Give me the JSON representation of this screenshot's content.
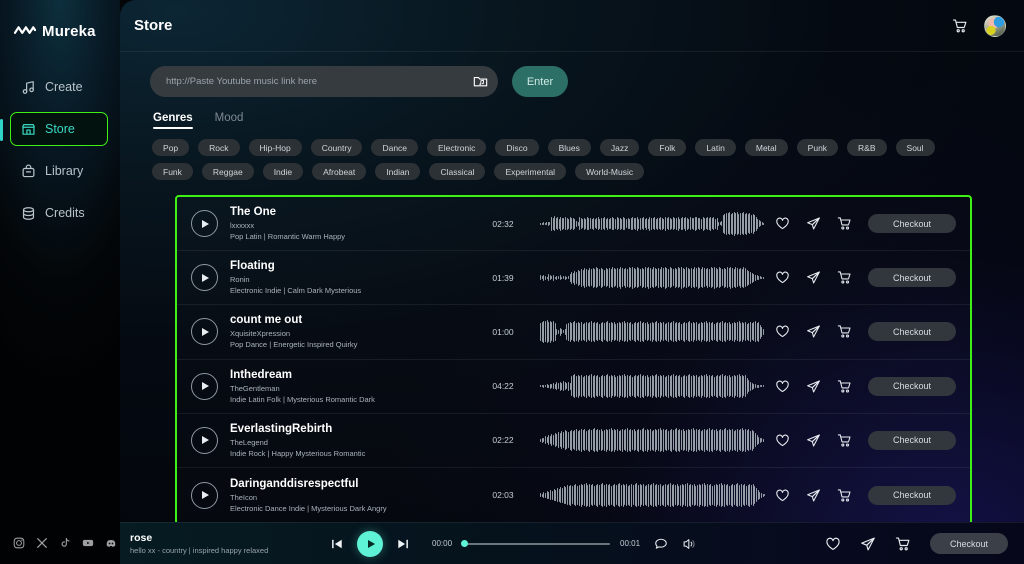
{
  "brand": {
    "name": "Mureka",
    "logo_icon": "waveform-logo-icon"
  },
  "sidebar": {
    "items": [
      {
        "label": "Create",
        "icon": "music-note-icon",
        "active": false
      },
      {
        "label": "Store",
        "icon": "storefront-icon",
        "active": true
      },
      {
        "label": "Library",
        "icon": "bag-icon",
        "active": false
      },
      {
        "label": "Credits",
        "icon": "database-icon",
        "active": false
      }
    ],
    "social": [
      {
        "name": "instagram-icon"
      },
      {
        "name": "x-twitter-icon"
      },
      {
        "name": "tiktok-icon"
      },
      {
        "name": "youtube-icon"
      },
      {
        "name": "discord-icon"
      }
    ]
  },
  "header": {
    "title": "Store",
    "cart_icon": "cart-icon",
    "avatar_icon": "user-avatar"
  },
  "search": {
    "placeholder": "http://Paste Youtube music link here",
    "value": "",
    "folder_icon": "folder-music-icon",
    "enter_label": "Enter"
  },
  "tabs": [
    {
      "label": "Genres",
      "active": true
    },
    {
      "label": "Mood",
      "active": false
    }
  ],
  "genres": [
    "Pop",
    "Rock",
    "Hip-Hop",
    "Country",
    "Dance",
    "Electronic",
    "Disco",
    "Blues",
    "Jazz",
    "Folk",
    "Latin",
    "Metal",
    "Punk",
    "R&B",
    "Soul",
    "Funk",
    "Reggae",
    "Indie",
    "Afrobeat",
    "Indian",
    "Classical",
    "Experimental",
    "World-Music"
  ],
  "tracks": [
    {
      "title": "The One",
      "artist": "lxxxxxx",
      "tags": "Pop Latin | Romantic Warm Happy",
      "duration": "02:32",
      "checkout_label": "Checkout",
      "waveform": [
        2,
        2,
        3,
        2,
        3,
        4,
        3,
        14,
        12,
        15,
        11,
        13,
        10,
        14,
        12,
        11,
        13,
        12,
        10,
        13,
        11,
        12,
        10,
        6,
        4,
        13,
        11,
        9,
        12,
        10,
        13,
        12,
        11,
        10,
        12,
        9,
        11,
        13,
        10,
        12,
        11,
        13,
        9,
        12,
        10,
        11,
        13,
        12,
        10,
        13,
        11,
        12,
        10,
        13,
        12,
        9,
        11,
        10,
        12,
        13,
        11,
        12,
        14,
        10,
        12,
        11,
        13,
        9,
        12,
        10,
        14,
        12,
        11,
        13,
        10,
        12,
        11,
        13,
        12,
        10,
        14,
        11,
        13,
        12,
        10,
        13,
        11,
        12,
        14,
        10,
        12,
        13,
        11,
        14,
        12,
        10,
        13,
        11,
        12,
        14,
        13,
        11,
        12,
        10,
        14,
        12,
        11,
        13,
        12,
        14,
        11,
        13,
        10,
        12,
        4,
        3,
        5,
        18,
        20,
        22,
        21,
        23,
        20,
        22,
        24,
        21,
        23,
        20,
        22,
        21,
        23,
        20,
        22,
        19,
        21,
        18,
        20,
        17,
        14,
        10,
        7,
        5,
        3,
        2
      ]
    },
    {
      "title": "Floating",
      "artist": "Ronin",
      "tags": "Electronic Indie | Calm Dark Mysterious",
      "duration": "01:39",
      "checkout_label": "Checkout",
      "waveform": [
        5,
        3,
        6,
        4,
        2,
        7,
        5,
        3,
        6,
        2,
        4,
        3,
        5,
        2,
        3,
        4,
        2,
        3,
        8,
        12,
        10,
        14,
        12,
        16,
        14,
        18,
        16,
        20,
        18,
        16,
        19,
        17,
        20,
        18,
        21,
        19,
        17,
        20,
        18,
        16,
        19,
        17,
        20,
        18,
        21,
        19,
        17,
        20,
        18,
        22,
        19,
        17,
        20,
        18,
        21,
        19,
        22,
        20,
        18,
        21,
        19,
        17,
        20,
        18,
        21,
        19,
        22,
        20,
        18,
        21,
        19,
        17,
        20,
        18,
        21,
        19,
        22,
        20,
        18,
        21,
        19,
        17,
        20,
        18,
        21,
        19,
        22,
        20,
        18,
        21,
        19,
        17,
        20,
        18,
        21,
        19,
        22,
        20,
        18,
        21,
        19,
        17,
        20,
        18,
        21,
        19,
        22,
        20,
        18,
        21,
        19,
        17,
        20,
        18,
        21,
        19,
        22,
        20,
        18,
        21,
        19,
        17,
        20,
        18,
        21,
        19,
        16,
        14,
        12,
        10,
        8,
        6,
        5,
        4,
        3,
        2,
        2,
        2
      ]
    },
    {
      "title": "count me out",
      "artist": "XquisiteXpression",
      "tags": "Pop Dance | Energetic Inspired Quirky",
      "duration": "01:00",
      "checkout_label": "Checkout",
      "waveform": [
        18,
        20,
        22,
        21,
        23,
        20,
        22,
        19,
        21,
        18,
        6,
        4,
        8,
        5,
        3,
        6,
        16,
        18,
        20,
        17,
        19,
        21,
        18,
        20,
        17,
        19,
        16,
        18,
        20,
        17,
        19,
        21,
        18,
        20,
        17,
        19,
        16,
        18,
        20,
        17,
        19,
        21,
        18,
        20,
        17,
        19,
        16,
        18,
        20,
        17,
        19,
        21,
        18,
        20,
        17,
        19,
        16,
        18,
        20,
        17,
        19,
        21,
        18,
        20,
        17,
        19,
        16,
        18,
        20,
        17,
        19,
        21,
        18,
        20,
        17,
        19,
        16,
        18,
        20,
        17,
        19,
        21,
        18,
        20,
        17,
        19,
        16,
        18,
        20,
        17,
        19,
        21,
        18,
        20,
        17,
        19,
        16,
        18,
        20,
        17,
        19,
        21,
        18,
        20,
        17,
        19,
        16,
        18,
        20,
        17,
        19,
        21,
        18,
        20,
        17,
        19,
        16,
        18,
        20,
        17,
        19,
        21,
        18,
        20,
        17,
        19,
        16,
        18,
        20,
        17,
        19,
        21,
        18,
        20,
        14,
        10,
        6,
        4
      ]
    },
    {
      "title": "Inthedream",
      "artist": "TheGentleman",
      "tags": "Indie Latin Folk | Mysterious Romantic Dark",
      "duration": "04:22",
      "checkout_label": "Checkout",
      "waveform": [
        2,
        2,
        3,
        2,
        4,
        3,
        5,
        4,
        6,
        5,
        8,
        6,
        9,
        7,
        10,
        8,
        6,
        9,
        7,
        20,
        22,
        24,
        21,
        23,
        20,
        22,
        19,
        21,
        23,
        20,
        22,
        24,
        21,
        23,
        20,
        22,
        19,
        21,
        23,
        20,
        22,
        24,
        21,
        23,
        20,
        22,
        19,
        21,
        23,
        20,
        22,
        24,
        21,
        23,
        20,
        22,
        19,
        21,
        23,
        20,
        22,
        24,
        21,
        23,
        20,
        22,
        19,
        21,
        23,
        20,
        22,
        24,
        21,
        23,
        20,
        22,
        19,
        21,
        23,
        20,
        22,
        24,
        21,
        23,
        20,
        22,
        19,
        21,
        23,
        20,
        22,
        24,
        21,
        23,
        20,
        22,
        19,
        21,
        23,
        20,
        22,
        24,
        21,
        23,
        20,
        22,
        19,
        21,
        23,
        20,
        22,
        24,
        21,
        23,
        20,
        22,
        19,
        21,
        23,
        20,
        22,
        24,
        21,
        23,
        20,
        22,
        16,
        12,
        9,
        7,
        5,
        4,
        3,
        3,
        2,
        2,
        2,
        2
      ]
    },
    {
      "title": "EverlastingRebirth",
      "artist": "TheLegend",
      "tags": "Indie Rock | Happy Mysterious Romantic",
      "duration": "02:22",
      "checkout_label": "Checkout",
      "waveform": [
        3,
        5,
        4,
        8,
        6,
        10,
        8,
        12,
        10,
        14,
        12,
        16,
        14,
        18,
        16,
        20,
        18,
        16,
        19,
        21,
        18,
        20,
        22,
        19,
        21,
        23,
        20,
        22,
        19,
        21,
        23,
        20,
        22,
        24,
        21,
        23,
        20,
        22,
        19,
        21,
        23,
        20,
        22,
        24,
        21,
        23,
        20,
        22,
        19,
        21,
        23,
        20,
        22,
        24,
        21,
        23,
        20,
        22,
        19,
        21,
        23,
        20,
        22,
        24,
        21,
        23,
        20,
        22,
        19,
        21,
        23,
        20,
        22,
        24,
        21,
        23,
        20,
        22,
        19,
        21,
        23,
        20,
        22,
        24,
        21,
        23,
        20,
        22,
        19,
        21,
        23,
        20,
        22,
        24,
        21,
        23,
        20,
        22,
        19,
        21,
        23,
        20,
        22,
        24,
        21,
        23,
        20,
        22,
        19,
        21,
        23,
        20,
        22,
        24,
        21,
        23,
        20,
        22,
        19,
        21,
        23,
        20,
        22,
        24,
        21,
        23,
        20,
        22,
        19,
        21,
        18,
        14,
        10,
        7,
        5,
        4,
        3,
        2
      ]
    },
    {
      "title": "Daringanddisrespectful",
      "artist": "TheIcon",
      "tags": "Electronic Dance Indie | Mysterious Dark Angry",
      "duration": "02:03",
      "checkout_label": "Checkout",
      "waveform": [
        4,
        3,
        6,
        5,
        8,
        7,
        10,
        9,
        12,
        11,
        14,
        13,
        16,
        15,
        18,
        17,
        20,
        19,
        21,
        18,
        20,
        22,
        19,
        21,
        23,
        20,
        22,
        24,
        21,
        23,
        20,
        22,
        19,
        21,
        23,
        20,
        22,
        24,
        21,
        23,
        20,
        22,
        19,
        21,
        23,
        20,
        22,
        24,
        21,
        23,
        20,
        22,
        19,
        21,
        23,
        20,
        22,
        24,
        21,
        23,
        20,
        22,
        19,
        21,
        23,
        20,
        22,
        24,
        21,
        23,
        20,
        22,
        19,
        21,
        23,
        20,
        22,
        24,
        21,
        23,
        20,
        22,
        19,
        21,
        23,
        20,
        22,
        24,
        21,
        23,
        20,
        22,
        19,
        21,
        23,
        20,
        22,
        24,
        21,
        23,
        20,
        22,
        19,
        21,
        23,
        20,
        22,
        24,
        21,
        23,
        20,
        22,
        19,
        21,
        23,
        20,
        22,
        24,
        21,
        23,
        20,
        22,
        19,
        21,
        23,
        20,
        22,
        18,
        14,
        10,
        7,
        5,
        3,
        2
      ]
    }
  ],
  "row_icons": {
    "like": "heart-icon",
    "share": "send-icon",
    "cart": "cart-icon"
  },
  "player": {
    "now_playing_title": "rose",
    "now_playing_sub": "hello xx - country | inspired happy relaxed",
    "prev_icon": "skip-back-icon",
    "play_icon": "play-icon",
    "next_icon": "skip-forward-icon",
    "time_current": "00:00",
    "time_total": "00:01",
    "progress_percent": 0,
    "comment_icon": "comment-icon",
    "volume_icon": "volume-icon",
    "like_icon": "heart-icon",
    "share_icon": "send-icon",
    "cart_icon": "cart-icon",
    "checkout_label": "Checkout"
  },
  "colors": {
    "accent_green": "#3ff016",
    "accent_teal": "#5ef2d6",
    "enter_button": "#2c6f66",
    "chip_bg": "#2c3136",
    "sidebar_active_text": "#39d9c4"
  }
}
